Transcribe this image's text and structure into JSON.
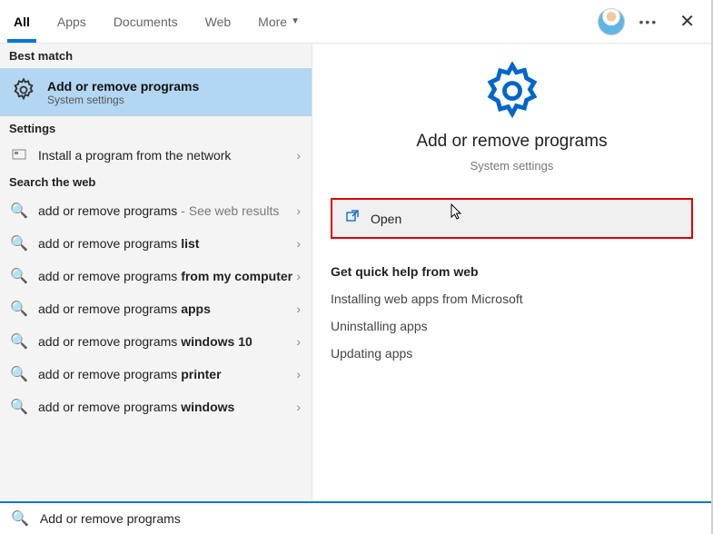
{
  "tabs": {
    "all": "All",
    "apps": "Apps",
    "documents": "Documents",
    "web": "Web",
    "more": "More"
  },
  "sections": {
    "best_match": "Best match",
    "settings": "Settings",
    "search_web": "Search the web"
  },
  "best_match": {
    "title": "Add or remove programs",
    "subtitle": "System settings"
  },
  "settings_items": [
    {
      "label": "Install a program from the network"
    }
  ],
  "web_items": [
    {
      "prefix": "add or remove programs",
      "bold": "",
      "suffix": " - See web results"
    },
    {
      "prefix": "add or remove programs ",
      "bold": "list",
      "suffix": ""
    },
    {
      "prefix": "add or remove programs ",
      "bold": "from my computer",
      "suffix": ""
    },
    {
      "prefix": "add or remove programs ",
      "bold": "apps",
      "suffix": ""
    },
    {
      "prefix": "add or remove programs ",
      "bold": "windows 10",
      "suffix": ""
    },
    {
      "prefix": "add or remove programs ",
      "bold": "printer",
      "suffix": ""
    },
    {
      "prefix": "add or remove programs ",
      "bold": "windows",
      "suffix": ""
    }
  ],
  "preview": {
    "title": "Add or remove programs",
    "subtitle": "System settings",
    "open": "Open",
    "help_header": "Get quick help from web",
    "help_items": [
      "Installing web apps from Microsoft",
      "Uninstalling apps",
      "Updating apps"
    ]
  },
  "search_value": "Add or remove programs"
}
